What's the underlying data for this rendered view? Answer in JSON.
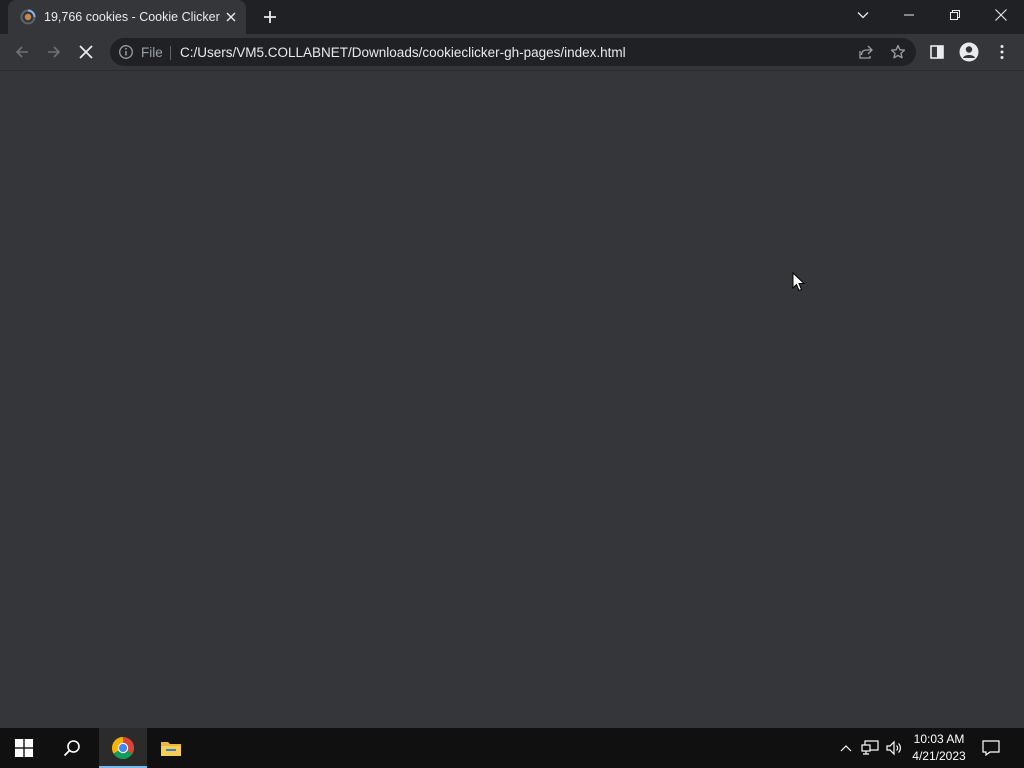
{
  "browser": {
    "tab": {
      "title": "19,766 cookies - Cookie Clicker",
      "favicon": "cookie-loading-icon"
    },
    "new_tab_icon": "plus-icon",
    "window_controls": [
      "tab-search-icon",
      "minimize-icon",
      "restore-icon",
      "close-icon"
    ],
    "toolbar": {
      "back_icon": "back-arrow-icon",
      "forward_icon": "forward-arrow-icon",
      "stop_icon": "stop-loading-icon",
      "omnibox": {
        "info_icon": "info-icon",
        "scheme_label": "File",
        "url": "C:/Users/VM5.COLLABNET/Downloads/cookieclicker-gh-pages/index.html",
        "share_icon": "share-icon",
        "bookmark_icon": "star-icon"
      },
      "side_panel_icon": "side-panel-icon",
      "profile_icon": "profile-icon",
      "menu_icon": "kebab-menu-icon"
    }
  },
  "taskbar": {
    "start_icon": "windows-start-icon",
    "search_icon": "search-icon",
    "apps": [
      {
        "name": "chrome-icon",
        "active": true
      },
      {
        "name": "file-explorer-icon",
        "active": false
      }
    ],
    "tray": [
      "chevron-up-icon",
      "network-icon",
      "volume-icon"
    ],
    "clock": {
      "time": "10:03 AM",
      "date": "4/21/2023"
    },
    "notification_icon": "action-center-icon"
  },
  "colors": {
    "tabstrip_bg": "#202124",
    "toolbar_bg": "#35363a",
    "omnibox_bg": "#202124",
    "taskbar_bg": "#101010",
    "taskbar_accent": "#76b9ed"
  }
}
